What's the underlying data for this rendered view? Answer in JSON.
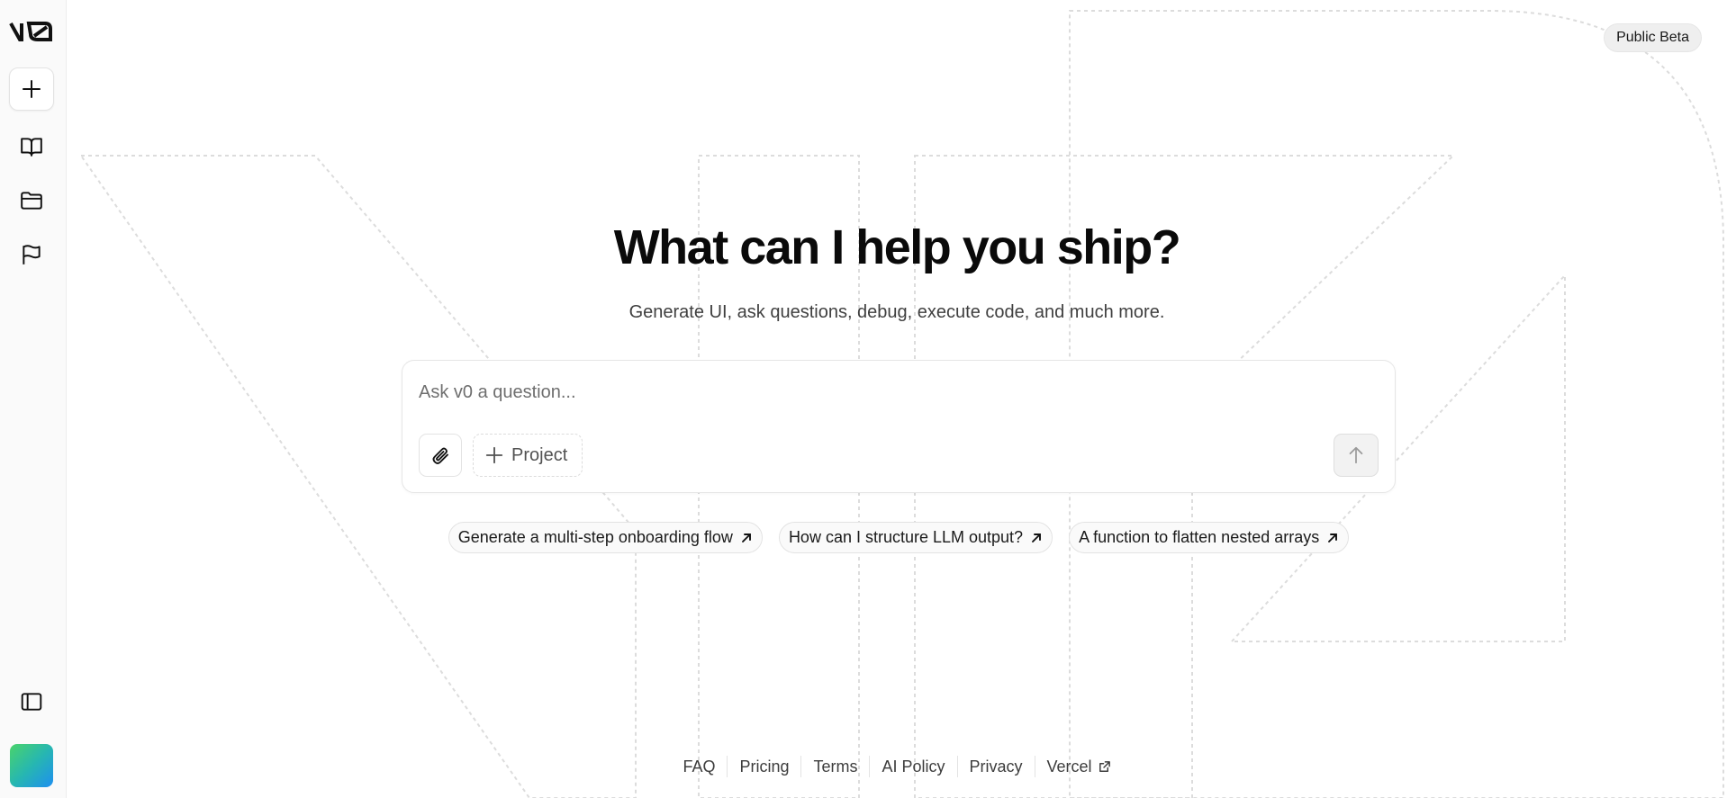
{
  "sidebar": {
    "logo_icon": "v0-logo-icon",
    "new_chat_icon": "plus-icon",
    "library_icon": "book-open-icon",
    "projects_icon": "folder-icon",
    "feedback_icon": "flag-icon",
    "toggle_icon": "sidebar-toggle-icon"
  },
  "header": {
    "badge": "Public Beta"
  },
  "hero": {
    "title": "What can I help you ship?",
    "subtitle": "Generate UI, ask questions, debug, execute code, and much more."
  },
  "chat": {
    "placeholder": "Ask v0 a question...",
    "attach_icon": "paperclip-icon",
    "project_label": "Project",
    "send_icon": "arrow-up-icon"
  },
  "suggestions": [
    {
      "label": "Generate a multi-step onboarding flow"
    },
    {
      "label": "How can I structure LLM output?"
    },
    {
      "label": "A function to flatten nested arrays"
    }
  ],
  "footer": {
    "links": [
      "FAQ",
      "Pricing",
      "Terms",
      "AI Policy",
      "Privacy",
      "Vercel"
    ]
  },
  "colors": {
    "accent_gradient_start": "#4ad36b",
    "accent_gradient_end": "#1e8ff0"
  }
}
